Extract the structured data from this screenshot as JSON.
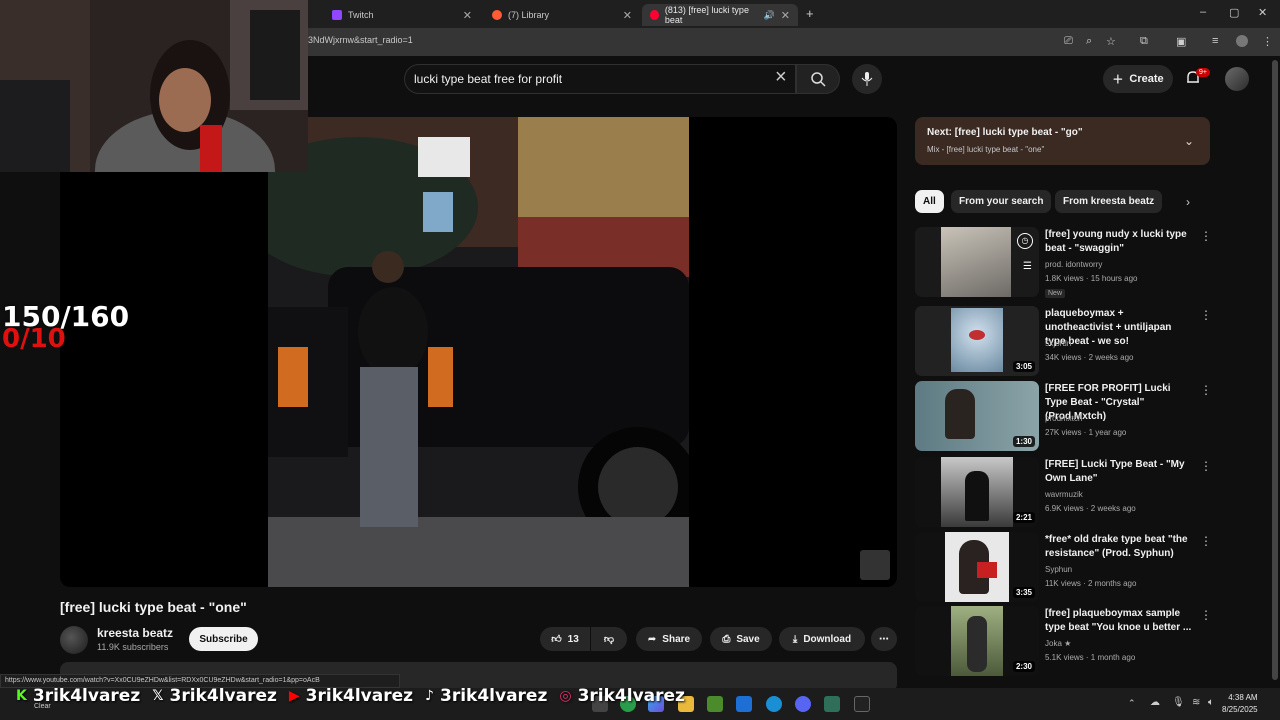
{
  "browser": {
    "tabs": [
      {
        "label": "Twitch",
        "icon": "twitch-icon",
        "color": "#9146ff"
      },
      {
        "label": "(7) Library",
        "icon": "library-icon",
        "color": "#ff5c35"
      },
      {
        "label": "(813) [free] lucki type beat",
        "icon": "youtube-icon",
        "color": "#ff0033"
      }
    ],
    "url": "3NdWjxrnw&start_radio=1",
    "status_url": "https://www.youtube.com/watch?v=Xx0CU9eZHDw&list=RDXx0CU9eZHDw&start_radio=1&pp=oAcB"
  },
  "youtube": {
    "search_query": "lucki type beat free for profit",
    "create_label": "Create",
    "notif_badge": "9+"
  },
  "stream_overlay": {
    "counter_main": "150/160",
    "counter_sub": "0/10",
    "socials": [
      {
        "icon": "kick-icon",
        "handle": "3rik4lvarez",
        "color": "#53fc18"
      },
      {
        "icon": "x-icon",
        "handle": "3rik4lvarez",
        "color": "#ffffff"
      },
      {
        "icon": "youtube-icon",
        "handle": "3rik4lvarez",
        "color": "#ff0000"
      },
      {
        "icon": "tiktok-icon",
        "handle": "3rik4lvarez",
        "color": "#ffffff"
      },
      {
        "icon": "instagram-icon",
        "handle": "3rik4lvarez",
        "color": "#e1306c"
      }
    ]
  },
  "video": {
    "title": "[free] lucki type beat - \"one\"",
    "channel": "kreesta beatz",
    "subscribers": "11.9K subscribers",
    "subscribe_label": "Subscribe",
    "likes": "13",
    "share_label": "Share",
    "save_label": "Save",
    "download_label": "Download"
  },
  "sidebar": {
    "next_title": "Next: [free] lucki type beat - \"go\"",
    "next_sub": "Mix - [free] lucki type beat - \"one\"",
    "chips": [
      "All",
      "From your search",
      "From kreesta beatz"
    ],
    "recommendations": [
      {
        "title": "[free] young nudy x lucki type beat - \"swaggin\"",
        "channel": "prod. idontworry",
        "meta": "1.8K views · 15 hours ago",
        "badge": "New",
        "duration": ""
      },
      {
        "title": "plaqueboymax + unotheactivist + untiljapan type beat - we so!",
        "channel": "5kjordn",
        "meta": "34K views · 2 weeks ago",
        "badge": "",
        "duration": "3:05"
      },
      {
        "title": "[FREE FOR PROFIT] Lucki Type Beat - \"Crystal\" (Prod.Mxtch)",
        "channel": "prodmxtch",
        "meta": "27K views · 1 year ago",
        "badge": "",
        "duration": "1:30"
      },
      {
        "title": "[FREE] Lucki Type Beat - \"My Own Lane\"",
        "channel": "wavrmuzik",
        "meta": "6.9K views · 2 weeks ago",
        "badge": "",
        "duration": "2:21"
      },
      {
        "title": "*free* old drake type beat \"the resistance\" (Prod. Syphun)",
        "channel": "Syphun",
        "meta": "11K views · 2 months ago",
        "badge": "",
        "duration": "3:35"
      },
      {
        "title": "[free] plaqueboymax sample type beat \"You knoe u better ...",
        "channel": "Joka ★",
        "meta": "5.1K views · 1 month ago",
        "badge": "",
        "duration": "2:30"
      }
    ]
  },
  "taskbar": {
    "weather": "Clear",
    "time": "4:38 AM",
    "date": "8/25/2025"
  }
}
